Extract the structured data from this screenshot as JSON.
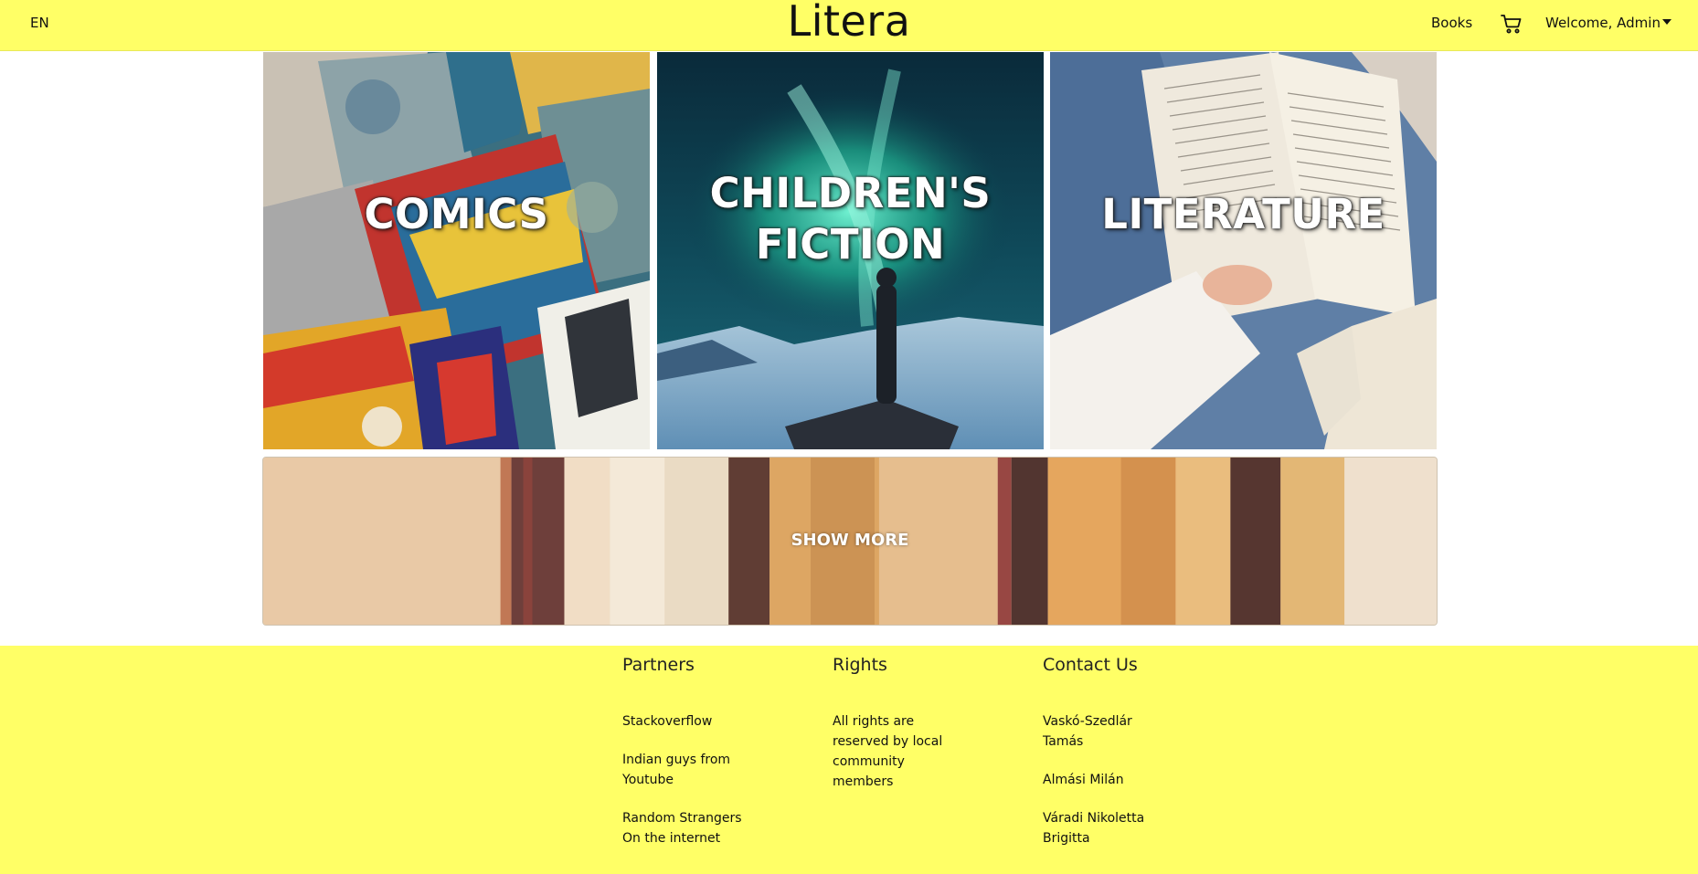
{
  "header": {
    "language": "EN",
    "brand": "Litera",
    "nav_books": "Books",
    "cart_icon": "cart-icon",
    "welcome": "Welcome, Admin"
  },
  "categories": [
    {
      "line1": "COMICS",
      "line2": ""
    },
    {
      "line1": "CHILDREN'S",
      "line2": "FICTION"
    },
    {
      "line1": "LITERATURE",
      "line2": ""
    }
  ],
  "show_more": "SHOW MORE",
  "footer": {
    "partners": {
      "title": "Partners",
      "items": [
        "Stackoverflow",
        "Indian guys from Youtube",
        "Random Strangers On the internet"
      ]
    },
    "rights": {
      "title": "Rights",
      "text": "All rights are reserved by local community members"
    },
    "contact": {
      "title": "Contact Us",
      "items": [
        "Vaskó-Szedlár Tamás",
        "Almási Milán",
        "Váradi Nikoletta Brigitta"
      ]
    }
  },
  "colors": {
    "header_bg": "#ffff66",
    "footer_bg": "#ffff66"
  }
}
